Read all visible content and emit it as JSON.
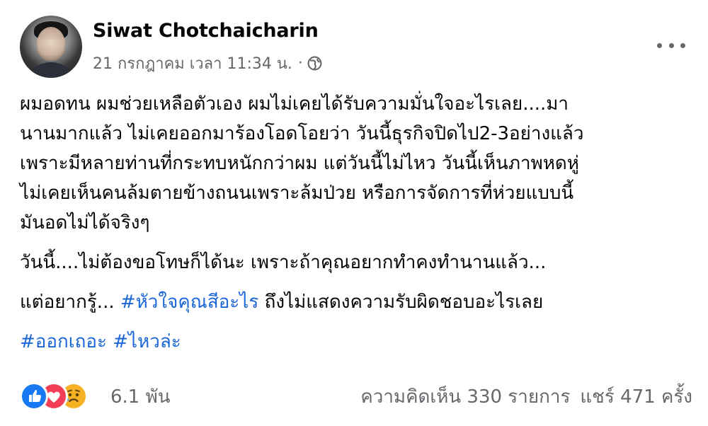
{
  "post": {
    "author": "Siwat Chotchaicharin",
    "timestamp": "21 กรกฎาคม เวลา 11:34 น.",
    "separator": "·",
    "audience_icon": "globe-icon",
    "more_icon": "more-options-icon",
    "paragraphs": [
      {
        "lines": [
          "ผมอดทน ผมช่วยเหลือตัวเอง ผมไม่เคยได้รับความมั่นใจอะไรเลย....มา",
          "นานมากแล้ว ไม่เคยออกมาร้องโอดโอยว่า วันนี้ธุรกิจปิดไป2-3อย่างแล้ว",
          "เพราะมีหลายท่านที่กระทบหนักกว่าผม แต่วันนี้ไม่ไหว วันนี้เห็นภาพหดหู่",
          "ไม่เคยเห็นคนล้มตายข้างถนนเพราะล้มป่วย หรือการจัดการที่ห่วยแบบนี้",
          "มันอดไม่ได้จริงๆ"
        ]
      },
      {
        "text": "วันนี้....ไม่ต้องขอโทษก็ได้นะ เพราะถ้าคุณอยากทำคงทำนานแล้ว..."
      },
      {
        "prefix": "แต่อยากรู้... ",
        "hashtag": "#หัวใจคุณสีอะไร",
        "suffix": " ถึงไม่แสดงความรับผิดชอบอะไรเลย"
      },
      {
        "hashtags": [
          "#ออกเถอะ",
          "#ไหวล่ะ"
        ]
      }
    ],
    "reactions": {
      "icons": [
        "like-reaction-icon",
        "love-reaction-icon",
        "sad-reaction-icon"
      ],
      "count": "6.1 พัน"
    },
    "comments": "ความคิดเห็น 330 รายการ",
    "shares": "แชร์ 471 ครั้ง",
    "colors": {
      "hashtag": "#1b66d6",
      "secondary_text": "#65676b",
      "like": "#1877f2",
      "love": "#f33e58",
      "sad": "#f7b125"
    }
  }
}
